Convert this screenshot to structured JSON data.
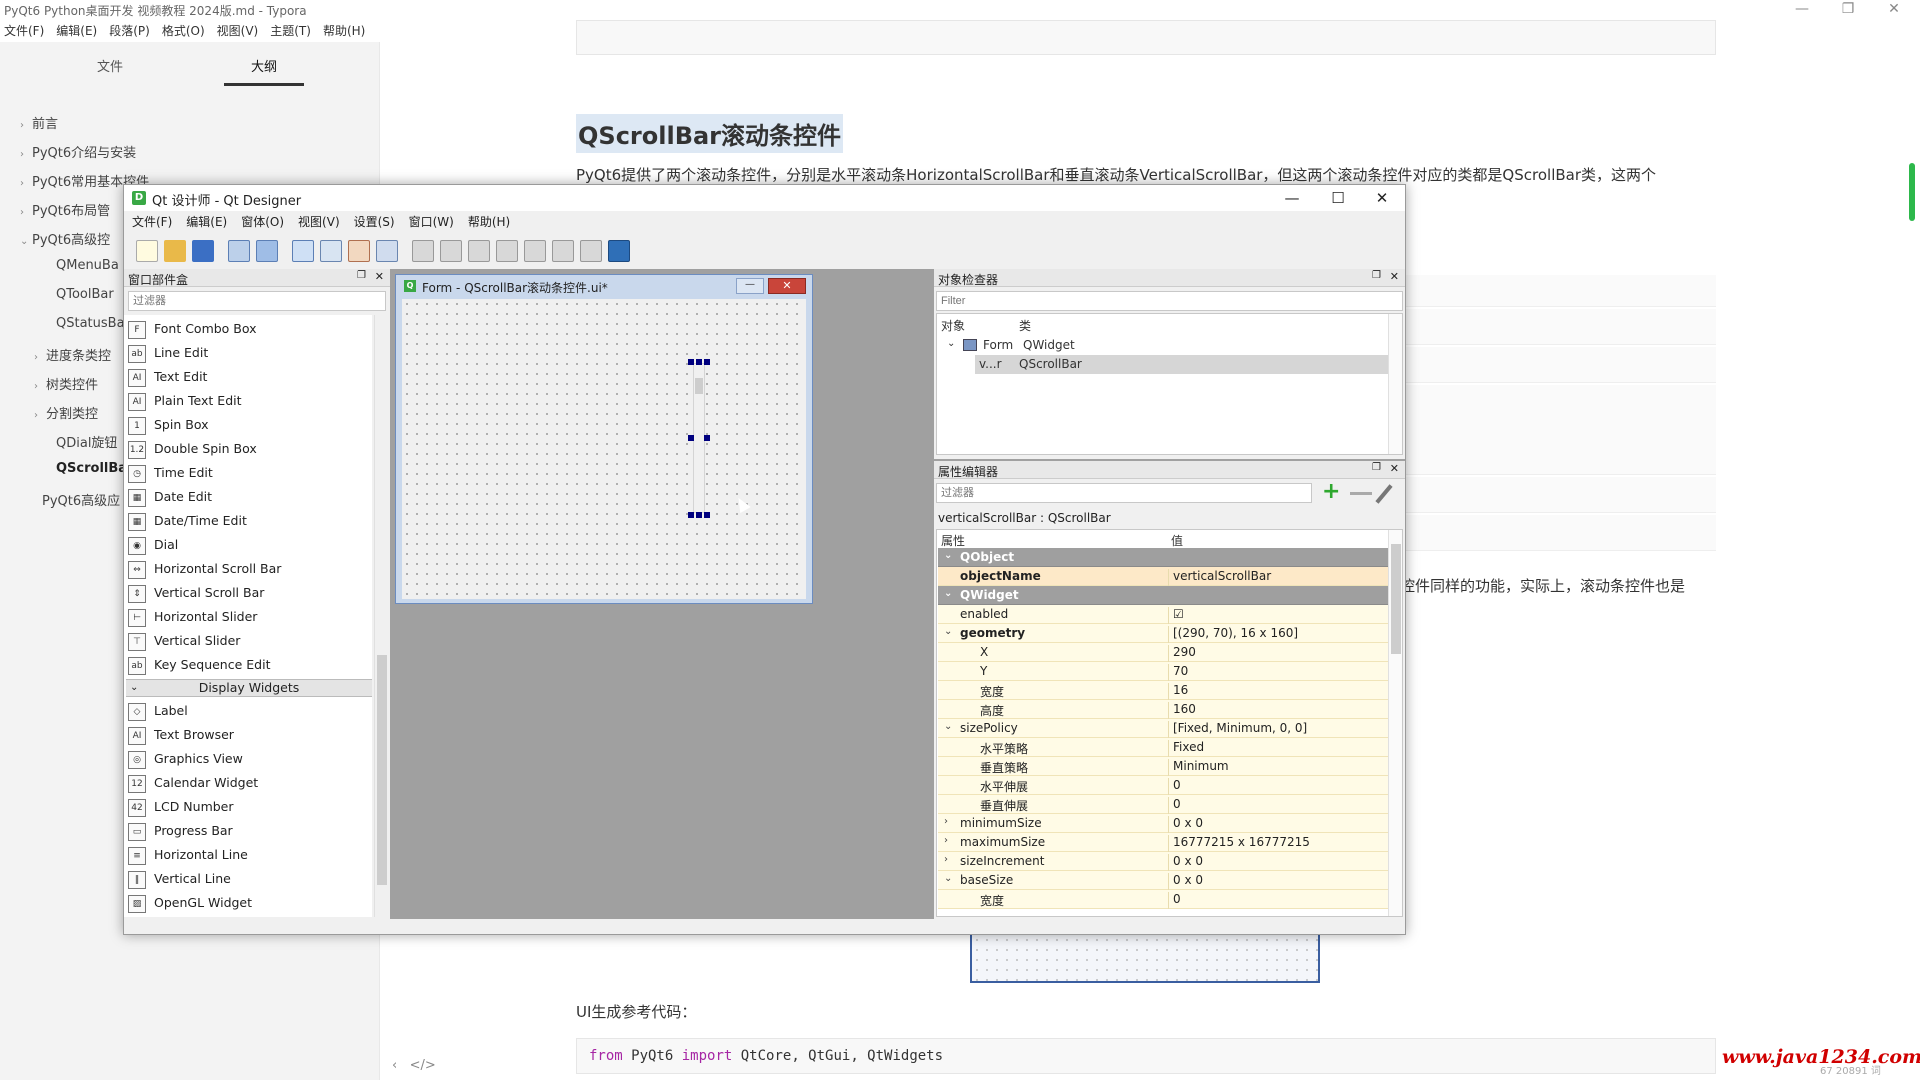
{
  "typora": {
    "window_title": "PyQt6 Python桌面开发 视频教程 2024版.md - Typora",
    "window_controls": [
      "—",
      "❐",
      "✕"
    ],
    "menu": [
      "文件(F)",
      "编辑(E)",
      "段落(P)",
      "格式(O)",
      "视图(V)",
      "主题(T)",
      "帮助(H)"
    ],
    "sidebar": {
      "tabs": [
        "文件",
        "大纲"
      ],
      "active_tab": "大纲",
      "outline": [
        {
          "label": "前言",
          "chevron": "›"
        },
        {
          "label": "PyQt6介绍与安装",
          "chevron": "›"
        },
        {
          "label": "PyQt6常用基本控件",
          "chevron": "›"
        },
        {
          "label": "PyQt6布局管",
          "chevron": "›"
        },
        {
          "label": "PyQt6高级控",
          "chevron": "⌄"
        },
        {
          "label": "QMenuBa",
          "chevron": ""
        },
        {
          "label": "QToolBar",
          "chevron": ""
        },
        {
          "label": "QStatusBa",
          "chevron": ""
        },
        {
          "label": "进度条类控",
          "chevron": "›"
        },
        {
          "label": "树类控件",
          "chevron": "›"
        },
        {
          "label": "分割类控",
          "chevron": "›"
        },
        {
          "label": "QDial旋钮",
          "chevron": ""
        },
        {
          "label": "QScrollBa",
          "chevron": ""
        },
        {
          "label": "PyQt6高级应",
          "chevron": ""
        }
      ]
    },
    "doc": {
      "heading": "QScrollBar滚动条控件",
      "para1": "PyQt6提供了两个滚动条控件，分别是水平滚动条HorizontalScrollBar和垂直滚动条VerticalScrollBar，但这两个滚动条控件对应的类都是QScrollBar类，这两个",
      "para2": "控件同样的功能，实际上，滚动条控件也是",
      "ui_label": "UI生成参考代码：",
      "code": {
        "kw1": "from",
        "mod": " PyQt6 ",
        "kw2": "import",
        "rest": " QtCore, QtGui, QtWidgets"
      },
      "nav": "‹   </>",
      "status": "67 20891 词"
    },
    "watermark": "www.java1234.com"
  },
  "designer": {
    "title": "Qt 设计师 - Qt Designer",
    "title_icon": "D",
    "window_controls": [
      "—",
      "☐",
      "✕"
    ],
    "menu": [
      "文件(F)",
      "编辑(E)",
      "窗体(O)",
      "视图(V)",
      "设置(S)",
      "窗口(W)",
      "帮助(H)"
    ],
    "widget_box": {
      "title": "窗口部件盒",
      "filter_placeholder": "过滤器",
      "items": [
        {
          "label": "Font Combo Box",
          "icon": "F"
        },
        {
          "label": "Line Edit",
          "icon": "ab"
        },
        {
          "label": "Text Edit",
          "icon": "AI"
        },
        {
          "label": "Plain Text Edit",
          "icon": "AI"
        },
        {
          "label": "Spin Box",
          "icon": "1"
        },
        {
          "label": "Double Spin Box",
          "icon": "1.2"
        },
        {
          "label": "Time Edit",
          "icon": "◷"
        },
        {
          "label": "Date Edit",
          "icon": "▦"
        },
        {
          "label": "Date/Time Edit",
          "icon": "▦"
        },
        {
          "label": "Dial",
          "icon": "◉"
        },
        {
          "label": "Horizontal Scroll Bar",
          "icon": "⇔"
        },
        {
          "label": "Vertical Scroll Bar",
          "icon": "⇕"
        },
        {
          "label": "Horizontal Slider",
          "icon": "⊢"
        },
        {
          "label": "Vertical Slider",
          "icon": "⊤"
        },
        {
          "label": "Key Sequence Edit",
          "icon": "ab"
        }
      ],
      "category": "Display Widgets",
      "category_chevron": "⌄",
      "display_items": [
        {
          "label": "Label",
          "icon": "◇"
        },
        {
          "label": "Text Browser",
          "icon": "AI"
        },
        {
          "label": "Graphics View",
          "icon": "◎"
        },
        {
          "label": "Calendar Widget",
          "icon": "12"
        },
        {
          "label": "LCD Number",
          "icon": "42"
        },
        {
          "label": "Progress Bar",
          "icon": "▭"
        },
        {
          "label": "Horizontal Line",
          "icon": "≡"
        },
        {
          "label": "Vertical Line",
          "icon": "‖"
        },
        {
          "label": "OpenGL Widget",
          "icon": "▨"
        }
      ]
    },
    "form": {
      "title": "Form - QScrollBar滚动条控件.ui*",
      "icon": "Q",
      "min": "—",
      "close": "✕"
    },
    "object_inspector": {
      "title": "对象检查器",
      "filter_placeholder": "Filter",
      "col_object": "对象",
      "col_class": "类",
      "rows": [
        {
          "object": "Form",
          "class": "QWidget"
        },
        {
          "object": "v...r",
          "class": "QScrollBar"
        }
      ]
    },
    "property_editor": {
      "title": "属性编辑器",
      "filter_placeholder": "过滤器",
      "subject": "verticalScrollBar : QScrollBar",
      "col_prop": "属性",
      "col_value": "值",
      "rows": [
        {
          "k": "QObject",
          "v": "",
          "type": "group",
          "ex": "⌄"
        },
        {
          "k": "objectName",
          "v": "verticalScrollBar",
          "type": "obj",
          "ex": ""
        },
        {
          "k": "QWidget",
          "v": "",
          "type": "group",
          "ex": "⌄"
        },
        {
          "k": "enabled",
          "v": "☑",
          "type": "plain",
          "ex": ""
        },
        {
          "k": "geometry",
          "v": "[(290, 70), 16 x 160]",
          "type": "bold",
          "ex": "⌄"
        },
        {
          "k": "X",
          "v": "290",
          "type": "sub",
          "ex": ""
        },
        {
          "k": "Y",
          "v": "70",
          "type": "sub",
          "ex": ""
        },
        {
          "k": "宽度",
          "v": "16",
          "type": "sub",
          "ex": ""
        },
        {
          "k": "高度",
          "v": "160",
          "type": "sub",
          "ex": ""
        },
        {
          "k": "sizePolicy",
          "v": "[Fixed, Minimum, 0, 0]",
          "type": "plain",
          "ex": "⌄"
        },
        {
          "k": "水平策略",
          "v": "Fixed",
          "type": "sub",
          "ex": ""
        },
        {
          "k": "垂直策略",
          "v": "Minimum",
          "type": "sub",
          "ex": ""
        },
        {
          "k": "水平伸展",
          "v": "0",
          "type": "sub",
          "ex": ""
        },
        {
          "k": "垂直伸展",
          "v": "0",
          "type": "sub",
          "ex": ""
        },
        {
          "k": "minimumSize",
          "v": "0 x 0",
          "type": "plain",
          "ex": "›"
        },
        {
          "k": "maximumSize",
          "v": "16777215 x 16777215",
          "type": "plain",
          "ex": "›"
        },
        {
          "k": "sizeIncrement",
          "v": "0 x 0",
          "type": "plain",
          "ex": "›"
        },
        {
          "k": "baseSize",
          "v": "0 x 0",
          "type": "plain",
          "ex": "⌄"
        },
        {
          "k": "宽度",
          "v": "0",
          "type": "sub",
          "ex": ""
        }
      ]
    },
    "dock_controls": {
      "float": "❐",
      "close": "✕"
    }
  },
  "colors": {
    "accent": "#2db84b",
    "selection": "#00007f",
    "group_row": "#9f9f9f",
    "prop_row": "#fffbe6",
    "watermark": "#d00000"
  }
}
